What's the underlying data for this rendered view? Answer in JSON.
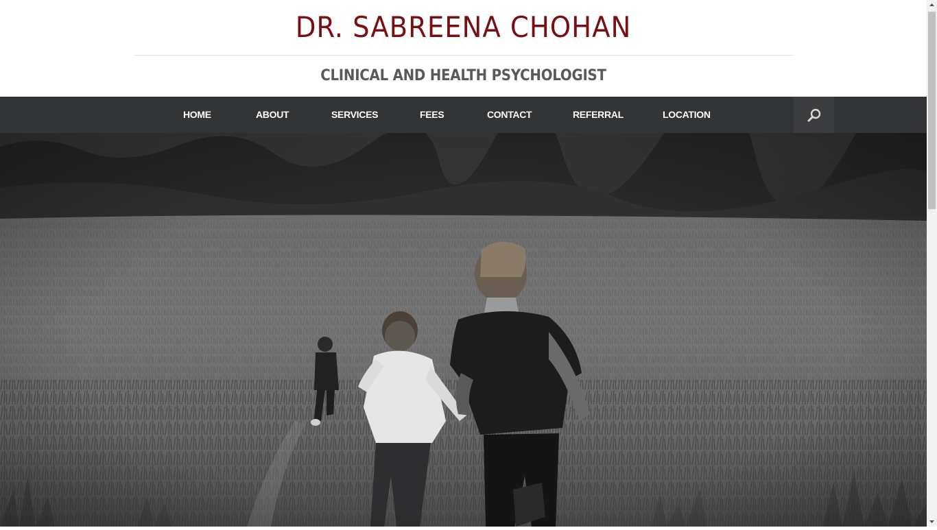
{
  "header": {
    "site_title": "DR. SABREENA CHOHAN",
    "tagline": "CLINICAL AND HEALTH PSYCHOLOGIST",
    "title_color": "#7a0f12"
  },
  "nav": {
    "items": [
      {
        "label": "HOME"
      },
      {
        "label": "ABOUT"
      },
      {
        "label": "SERVICES"
      },
      {
        "label": "FEES"
      },
      {
        "label": "CONTACT"
      },
      {
        "label": "REFERRAL"
      },
      {
        "label": "LOCATION"
      }
    ],
    "search_icon": "search-icon",
    "background_color": "#333436"
  },
  "hero": {
    "image_subject": "three children running through a grassy field, black and white"
  },
  "scrollbar": {
    "up_icon": "scroll-up-arrow",
    "down_icon": "scroll-down-arrow"
  }
}
